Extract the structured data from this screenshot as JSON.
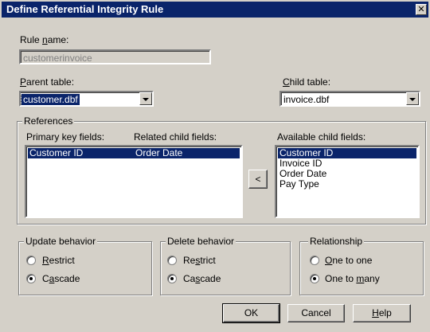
{
  "window": {
    "title": "Define Referential Integrity Rule",
    "close_glyph": "✕"
  },
  "rule_name": {
    "label_pre": "Rule ",
    "label_key": "n",
    "label_post": "ame:",
    "value": "customerinvoice"
  },
  "parent_table": {
    "label_pre": "",
    "label_key": "P",
    "label_post": "arent table:",
    "value": "customer.dbf"
  },
  "child_table": {
    "label_pre": "",
    "label_key": "C",
    "label_post": "hild table:",
    "value": "invoice.dbf"
  },
  "references": {
    "title": "References",
    "col_primary": "Primary key fields:",
    "col_related": "Related child fields:",
    "col_available": "Available child fields:",
    "rows": [
      {
        "primary": "Customer ID",
        "related": "Order Date"
      }
    ],
    "move_button": "<",
    "available": [
      "Customer ID",
      "Invoice ID",
      "Order Date",
      "Pay Type"
    ]
  },
  "update_behavior": {
    "title": "Update behavior",
    "options": [
      {
        "pre": "",
        "key": "R",
        "post": "estrict",
        "checked": false
      },
      {
        "pre": "C",
        "key": "a",
        "post": "scade",
        "checked": true
      }
    ]
  },
  "delete_behavior": {
    "title": "Delete behavior",
    "options": [
      {
        "pre": "Re",
        "key": "s",
        "post": "trict",
        "checked": false
      },
      {
        "pre": "Ca",
        "key": "s",
        "post": "cade",
        "checked": true
      }
    ]
  },
  "relationship": {
    "title": "Relationship",
    "options": [
      {
        "pre": "",
        "key": "O",
        "post": "ne to one",
        "checked": false
      },
      {
        "pre": "One to ",
        "key": "m",
        "post": "any",
        "checked": true
      }
    ]
  },
  "buttons": {
    "ok": "OK",
    "cancel": "Cancel",
    "help_key": "H",
    "help_post": "elp"
  }
}
